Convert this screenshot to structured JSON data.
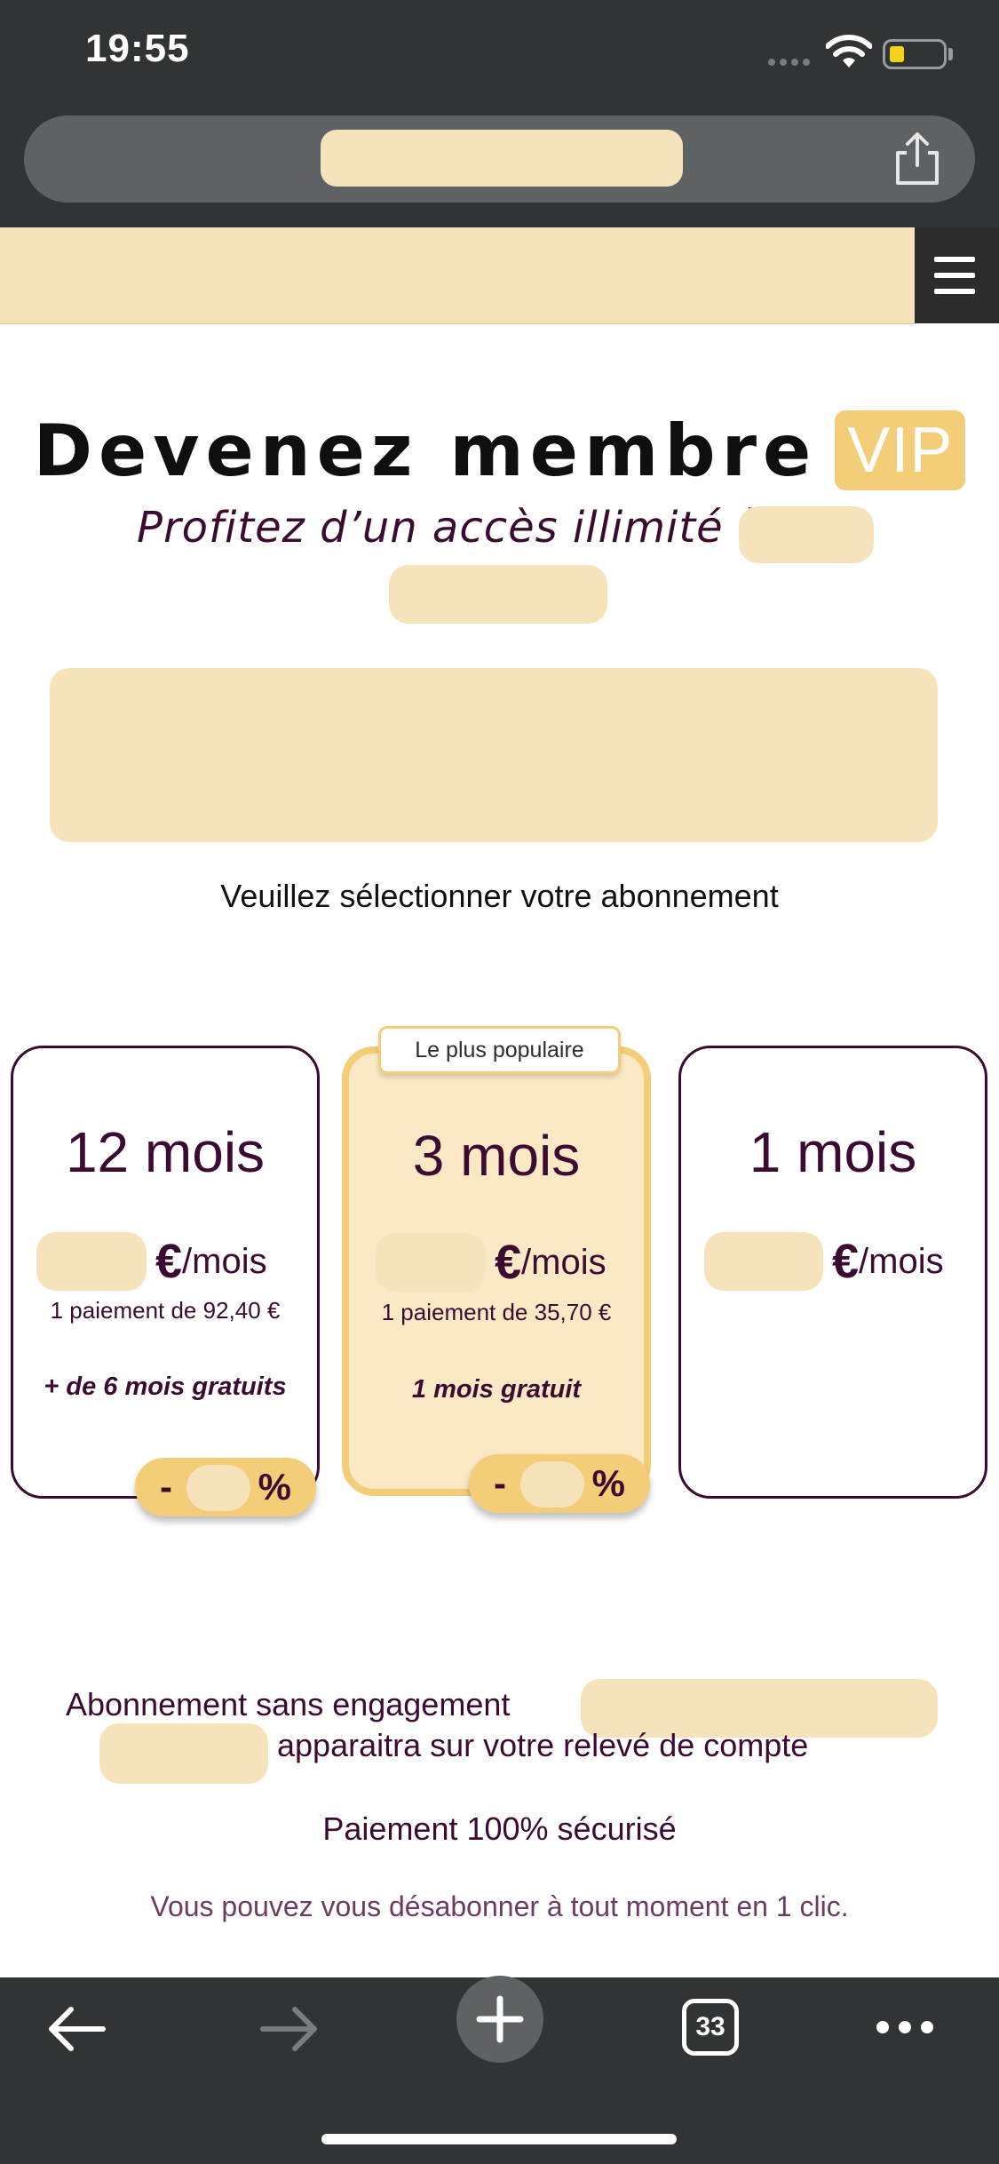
{
  "status_bar": {
    "time": "19:55"
  },
  "browser": {
    "tab_count": "33"
  },
  "hero": {
    "title": "Devenez membre",
    "vip": "VIP",
    "subtitle": "Profitez d’un accès illimité à"
  },
  "select_label": "Veuillez sélectionner votre abonnement",
  "plans": [
    {
      "period": "12 mois",
      "price_currency": "€",
      "price_unit": "/mois",
      "payment": "1 paiement de 92,40 €",
      "bonus": "+ de 6 mois gratuits",
      "discount_prefix": "-",
      "discount_suffix": "%"
    },
    {
      "period": "3 mois",
      "price_currency": "€",
      "price_unit": "/mois",
      "payment": "1 paiement de 35,70 €",
      "bonus": "1 mois gratuit",
      "discount_prefix": "-",
      "discount_suffix": "%",
      "tag": "Le plus populaire"
    },
    {
      "period": "1 mois",
      "price_currency": "€",
      "price_unit": "/mois"
    }
  ],
  "footer": {
    "line1": "Abonnement sans engagement",
    "line2": "apparaitra sur votre relevé de compte",
    "secure": "Paiement 100% sécurisé",
    "unsubscribe": "Vous pouvez vous désabonner à tout moment en 1 clic."
  },
  "colors": {
    "accent": "#f3cd78",
    "redacted": "#f6e3bb",
    "brand_text": "#3b0b31",
    "chrome": "#323335"
  },
  "icons": [
    "wifi-icon",
    "battery-icon",
    "share-icon",
    "menu-icon",
    "back-arrow-icon",
    "forward-arrow-icon",
    "plus-icon",
    "more-icon"
  ]
}
